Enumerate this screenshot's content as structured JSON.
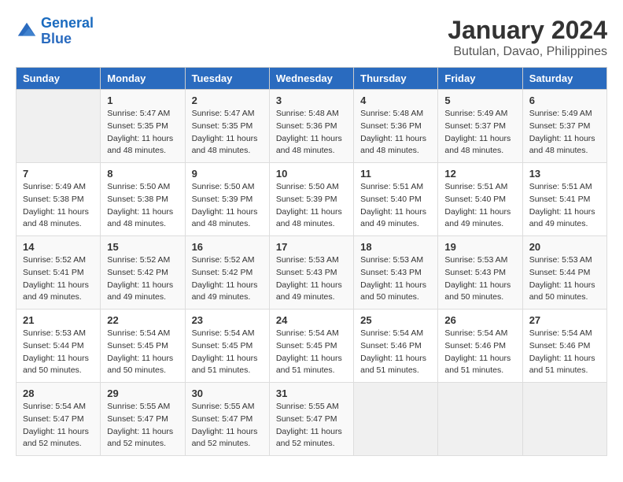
{
  "header": {
    "logo_line1": "General",
    "logo_line2": "Blue",
    "title": "January 2024",
    "subtitle": "Butulan, Davao, Philippines"
  },
  "days_of_week": [
    "Sunday",
    "Monday",
    "Tuesday",
    "Wednesday",
    "Thursday",
    "Friday",
    "Saturday"
  ],
  "weeks": [
    [
      {
        "day": "",
        "info": ""
      },
      {
        "day": "1",
        "info": "Sunrise: 5:47 AM\nSunset: 5:35 PM\nDaylight: 11 hours\nand 48 minutes."
      },
      {
        "day": "2",
        "info": "Sunrise: 5:47 AM\nSunset: 5:35 PM\nDaylight: 11 hours\nand 48 minutes."
      },
      {
        "day": "3",
        "info": "Sunrise: 5:48 AM\nSunset: 5:36 PM\nDaylight: 11 hours\nand 48 minutes."
      },
      {
        "day": "4",
        "info": "Sunrise: 5:48 AM\nSunset: 5:36 PM\nDaylight: 11 hours\nand 48 minutes."
      },
      {
        "day": "5",
        "info": "Sunrise: 5:49 AM\nSunset: 5:37 PM\nDaylight: 11 hours\nand 48 minutes."
      },
      {
        "day": "6",
        "info": "Sunrise: 5:49 AM\nSunset: 5:37 PM\nDaylight: 11 hours\nand 48 minutes."
      }
    ],
    [
      {
        "day": "7",
        "info": "Sunrise: 5:49 AM\nSunset: 5:38 PM\nDaylight: 11 hours\nand 48 minutes."
      },
      {
        "day": "8",
        "info": "Sunrise: 5:50 AM\nSunset: 5:38 PM\nDaylight: 11 hours\nand 48 minutes."
      },
      {
        "day": "9",
        "info": "Sunrise: 5:50 AM\nSunset: 5:39 PM\nDaylight: 11 hours\nand 48 minutes."
      },
      {
        "day": "10",
        "info": "Sunrise: 5:50 AM\nSunset: 5:39 PM\nDaylight: 11 hours\nand 48 minutes."
      },
      {
        "day": "11",
        "info": "Sunrise: 5:51 AM\nSunset: 5:40 PM\nDaylight: 11 hours\nand 49 minutes."
      },
      {
        "day": "12",
        "info": "Sunrise: 5:51 AM\nSunset: 5:40 PM\nDaylight: 11 hours\nand 49 minutes."
      },
      {
        "day": "13",
        "info": "Sunrise: 5:51 AM\nSunset: 5:41 PM\nDaylight: 11 hours\nand 49 minutes."
      }
    ],
    [
      {
        "day": "14",
        "info": "Sunrise: 5:52 AM\nSunset: 5:41 PM\nDaylight: 11 hours\nand 49 minutes."
      },
      {
        "day": "15",
        "info": "Sunrise: 5:52 AM\nSunset: 5:42 PM\nDaylight: 11 hours\nand 49 minutes."
      },
      {
        "day": "16",
        "info": "Sunrise: 5:52 AM\nSunset: 5:42 PM\nDaylight: 11 hours\nand 49 minutes."
      },
      {
        "day": "17",
        "info": "Sunrise: 5:53 AM\nSunset: 5:43 PM\nDaylight: 11 hours\nand 49 minutes."
      },
      {
        "day": "18",
        "info": "Sunrise: 5:53 AM\nSunset: 5:43 PM\nDaylight: 11 hours\nand 50 minutes."
      },
      {
        "day": "19",
        "info": "Sunrise: 5:53 AM\nSunset: 5:43 PM\nDaylight: 11 hours\nand 50 minutes."
      },
      {
        "day": "20",
        "info": "Sunrise: 5:53 AM\nSunset: 5:44 PM\nDaylight: 11 hours\nand 50 minutes."
      }
    ],
    [
      {
        "day": "21",
        "info": "Sunrise: 5:53 AM\nSunset: 5:44 PM\nDaylight: 11 hours\nand 50 minutes."
      },
      {
        "day": "22",
        "info": "Sunrise: 5:54 AM\nSunset: 5:45 PM\nDaylight: 11 hours\nand 50 minutes."
      },
      {
        "day": "23",
        "info": "Sunrise: 5:54 AM\nSunset: 5:45 PM\nDaylight: 11 hours\nand 51 minutes."
      },
      {
        "day": "24",
        "info": "Sunrise: 5:54 AM\nSunset: 5:45 PM\nDaylight: 11 hours\nand 51 minutes."
      },
      {
        "day": "25",
        "info": "Sunrise: 5:54 AM\nSunset: 5:46 PM\nDaylight: 11 hours\nand 51 minutes."
      },
      {
        "day": "26",
        "info": "Sunrise: 5:54 AM\nSunset: 5:46 PM\nDaylight: 11 hours\nand 51 minutes."
      },
      {
        "day": "27",
        "info": "Sunrise: 5:54 AM\nSunset: 5:46 PM\nDaylight: 11 hours\nand 51 minutes."
      }
    ],
    [
      {
        "day": "28",
        "info": "Sunrise: 5:54 AM\nSunset: 5:47 PM\nDaylight: 11 hours\nand 52 minutes."
      },
      {
        "day": "29",
        "info": "Sunrise: 5:55 AM\nSunset: 5:47 PM\nDaylight: 11 hours\nand 52 minutes."
      },
      {
        "day": "30",
        "info": "Sunrise: 5:55 AM\nSunset: 5:47 PM\nDaylight: 11 hours\nand 52 minutes."
      },
      {
        "day": "31",
        "info": "Sunrise: 5:55 AM\nSunset: 5:47 PM\nDaylight: 11 hours\nand 52 minutes."
      },
      {
        "day": "",
        "info": ""
      },
      {
        "day": "",
        "info": ""
      },
      {
        "day": "",
        "info": ""
      }
    ]
  ]
}
